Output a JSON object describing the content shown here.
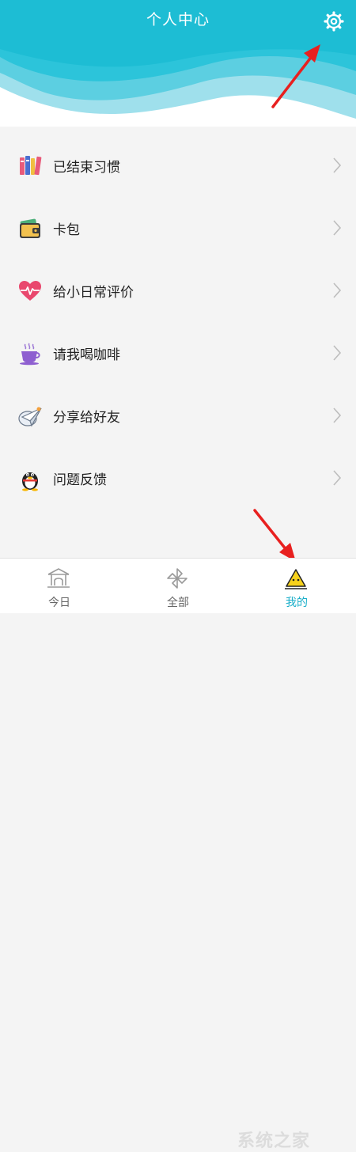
{
  "header": {
    "title": "个人中心",
    "settings_icon": "gear-icon",
    "accent_color": "#1dbdd4"
  },
  "menu": {
    "items": [
      {
        "label": "已结束习惯",
        "icon": "books-icon"
      },
      {
        "label": "卡包",
        "icon": "wallet-icon"
      },
      {
        "label": "给小日常评价",
        "icon": "heart-pulse-icon"
      },
      {
        "label": "请我喝咖啡",
        "icon": "coffee-cup-icon"
      },
      {
        "label": "分享给好友",
        "icon": "paper-plane-icon"
      },
      {
        "label": "问题反馈",
        "icon": "qq-penguin-icon"
      }
    ]
  },
  "tabbar": {
    "tabs": [
      {
        "label": "今日",
        "icon": "temple-icon",
        "active": false
      },
      {
        "label": "全部",
        "icon": "pinwheel-icon",
        "active": false
      },
      {
        "label": "我的",
        "icon": "triangle-avatar-icon",
        "active": true
      }
    ]
  },
  "watermark": {
    "text": "系统之家"
  }
}
